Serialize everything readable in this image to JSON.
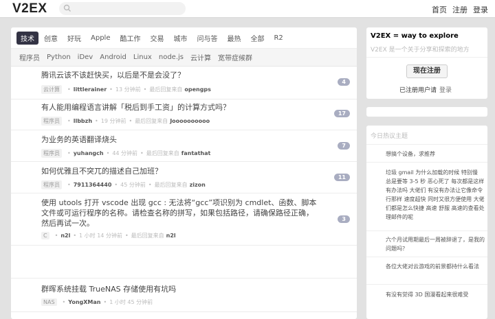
{
  "header": {
    "logo": "V2EX",
    "nav": [
      "首页",
      "注册",
      "登录"
    ]
  },
  "tabs": [
    "技术",
    "创意",
    "好玩",
    "Apple",
    "酷工作",
    "交易",
    "城市",
    "问与答",
    "最热",
    "全部",
    "R2"
  ],
  "active_tab": "技术",
  "subtabs": [
    "程序员",
    "Python",
    "iDev",
    "Android",
    "Linux",
    "node.js",
    "云计算",
    "宽带症候群"
  ],
  "topics": [
    {
      "title": "腾讯云该不该赶快买，以后是不是会没了？",
      "node": "云计算",
      "user": "littlerainer",
      "time": "13 分钟前",
      "last_label": "最后回复来自",
      "last_user": "opengps",
      "count": "4"
    },
    {
      "title": "有人能用编程语言讲解「税后到手工资」的计算方式吗？",
      "node": "程序员",
      "user": "llbbzh",
      "time": "19 分钟前",
      "last_label": "最后回复来自",
      "last_user": "Joooooooooo",
      "count": "17"
    },
    {
      "title": "为业务的英语翻译烧头",
      "node": "程序员",
      "user": "yuhangch",
      "time": "44 分钟前",
      "last_label": "最后回复来自",
      "last_user": "fantathat",
      "count": "7"
    },
    {
      "title": "如何优雅且不突兀的描述自己加班？",
      "node": "程序员",
      "user": "7911364440",
      "time": "45 分钟前",
      "last_label": "最后回复来自",
      "last_user": "zizon",
      "count": "11"
    },
    {
      "title": "使用 utools 打开 vscode 出现 gcc : 无法将“gcc”项识别为 cmdlet、函数、脚本文件或可运行程序的名称。请检查名称的拼写，如果包括路径，请确保路径正确，然后再试一次。",
      "node": "C",
      "user": "n2l",
      "time": "1 小时 14 分钟前",
      "last_label": "最后回复来自",
      "last_user": "n2l",
      "count": "3"
    },
    {
      "title": "群晖系统挂载 TrueNAS 存储使用有坑吗",
      "node": "NAS",
      "user": "YongXMan",
      "time": "1 小时 45 分钟前",
      "last_label": "",
      "last_user": "",
      "count": ""
    }
  ],
  "sidebar": {
    "title": "V2EX = way to explore",
    "subtitle": "V2EX 是一个关于分享和探索的地方",
    "signup_button": "现在注册",
    "registered_text": "已注册用户请",
    "login_link": "登录",
    "hot_title": "今日热议主题",
    "hot": [
      "想搞个设备，求推荐",
      "垃圾 gmail 为什么加载的时候 特别慢 总是要等 3-5 秒 恶心死了 每次都是这样 有办法吗 大佬们 有没有办法让它像命令行那样 速度超快 同时又很方便使用 大佬们都是怎么快捷 高速 舒服 高速的查看处理邮件的呢",
      "六个月试用期最后一周被辞退了，是我的问题吗？",
      "各位大佬对云游戏的前景都持什么看法",
      "有没有觉得 3D 国漫看起来很难受"
    ]
  }
}
